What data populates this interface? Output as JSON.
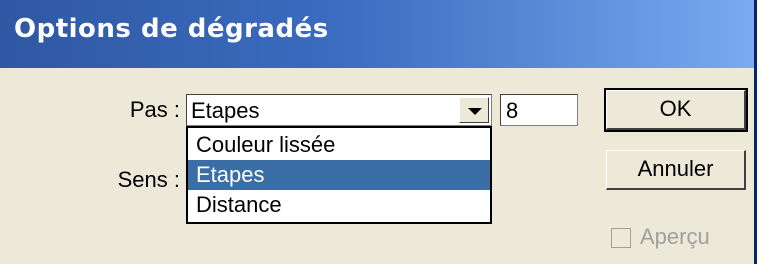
{
  "window": {
    "title": "Options de dégradés"
  },
  "pas": {
    "label": "Pas :",
    "selected": "Etapes",
    "options": [
      "Couleur lissée",
      "Etapes",
      "Distance"
    ],
    "value": "8"
  },
  "sens": {
    "label": "Sens :"
  },
  "buttons": {
    "ok": "OK",
    "cancel": "Annuler"
  },
  "preview": {
    "label": "Aperçu",
    "checked": false,
    "enabled": false
  },
  "colors": {
    "titlebar_start": "#2f58a3",
    "titlebar_end": "#7aaaf0",
    "selection": "#3a6ea5",
    "dialog_bg": "#ece9d8"
  }
}
